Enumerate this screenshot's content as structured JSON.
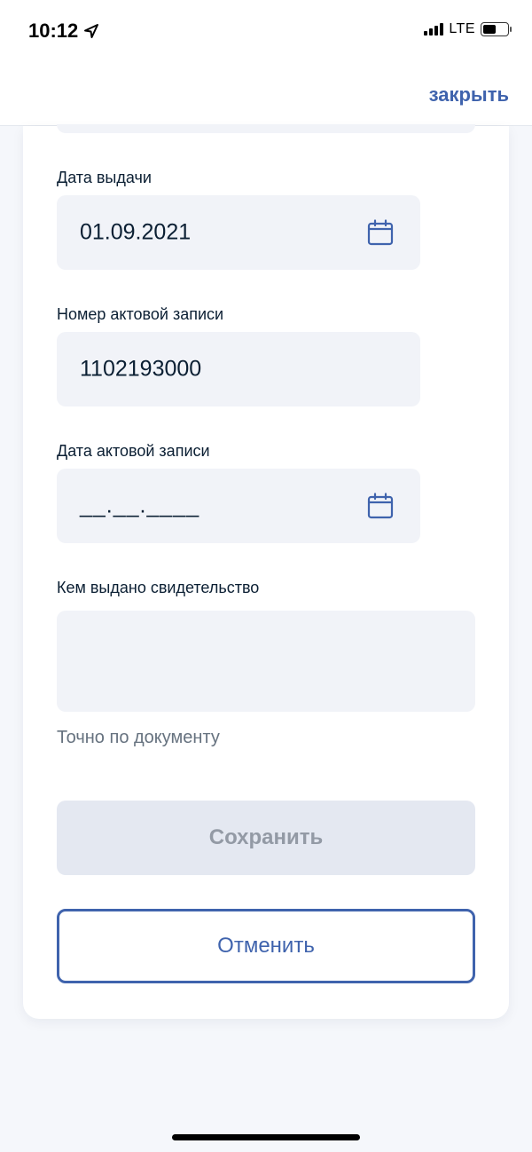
{
  "status_bar": {
    "time": "10:12",
    "network": "LTE"
  },
  "header": {
    "close_label": "закрыть"
  },
  "form": {
    "issue_date": {
      "label": "Дата выдачи",
      "value": "01.09.2021"
    },
    "record_number": {
      "label": "Номер актовой записи",
      "value": "1102193000"
    },
    "record_date": {
      "label": "Дата актовой записи",
      "value": "__.__.____"
    },
    "issued_by": {
      "label": "Кем выдано свидетельство",
      "value": "",
      "hint": "Точно по документу"
    }
  },
  "actions": {
    "save_label": "Сохранить",
    "cancel_label": "Отменить"
  },
  "colors": {
    "accent": "#3f63ad",
    "field_bg": "#f1f3f8",
    "disabled_bg": "#e4e8f1",
    "disabled_text": "#939aa5"
  }
}
